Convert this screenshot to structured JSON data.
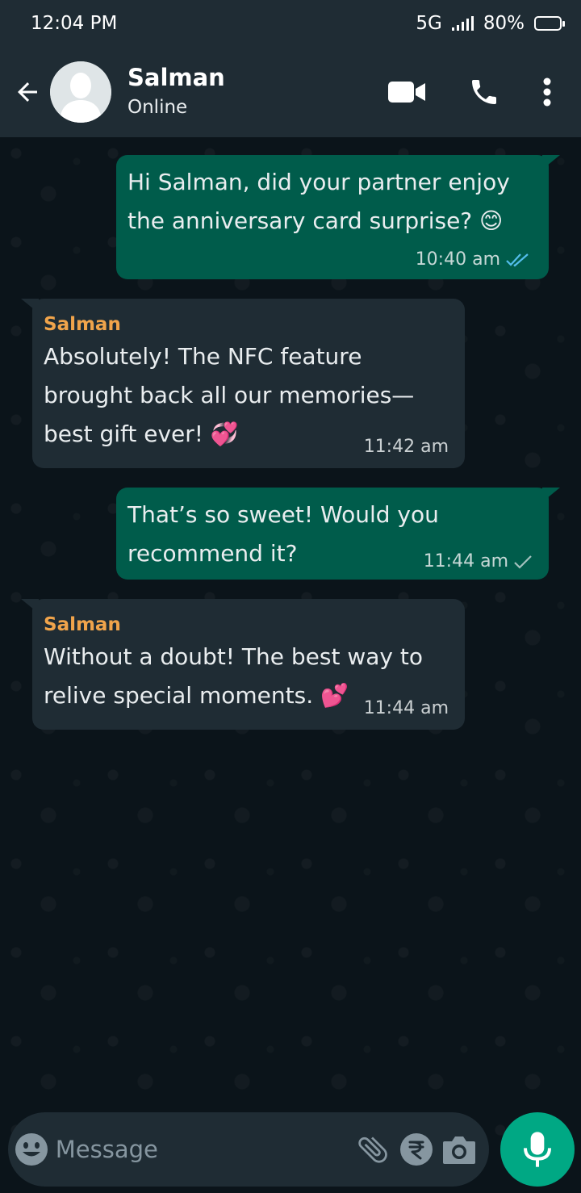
{
  "status_bar": {
    "time": "12:04 PM",
    "network": "5G",
    "battery": "80%",
    "battery_level": 0.8
  },
  "header": {
    "contact_name": "Salman",
    "contact_status": "Online",
    "icons": [
      "back-arrow-icon",
      "video-call-icon",
      "phone-icon",
      "more-vert-icon"
    ]
  },
  "messages": [
    {
      "direction": "out",
      "text": "Hi Salman, did your partner enjoy\nthe anniversary card surprise? 😊",
      "time": "10:40 am",
      "status": "read"
    },
    {
      "direction": "in",
      "sender": "Salman",
      "text": "Absolutely! The NFC feature\nbrought back all our memories—\nbest gift ever! 💞",
      "time": "11:42 am"
    },
    {
      "direction": "out",
      "text": "That’s so sweet! Would you\nrecommend it?",
      "time": "11:44 am",
      "status": "sent"
    },
    {
      "direction": "in",
      "sender": "Salman",
      "text": "Without a doubt! The best way to\nrelive special moments. 💕",
      "time": "11:44 am"
    }
  ],
  "composer": {
    "placeholder": "Message",
    "icons": [
      "emoji-icon",
      "attach-icon",
      "rupee-payment-icon",
      "camera-icon",
      "mic-icon"
    ]
  },
  "colors": {
    "background": "#0b141a",
    "header": "#1f2c34",
    "outgoing_bubble": "#005c4b",
    "incoming_bubble": "#1f2c34",
    "sender_name": "#f0a44b",
    "read_ticks": "#53bdeb",
    "accent": "#00a884"
  }
}
